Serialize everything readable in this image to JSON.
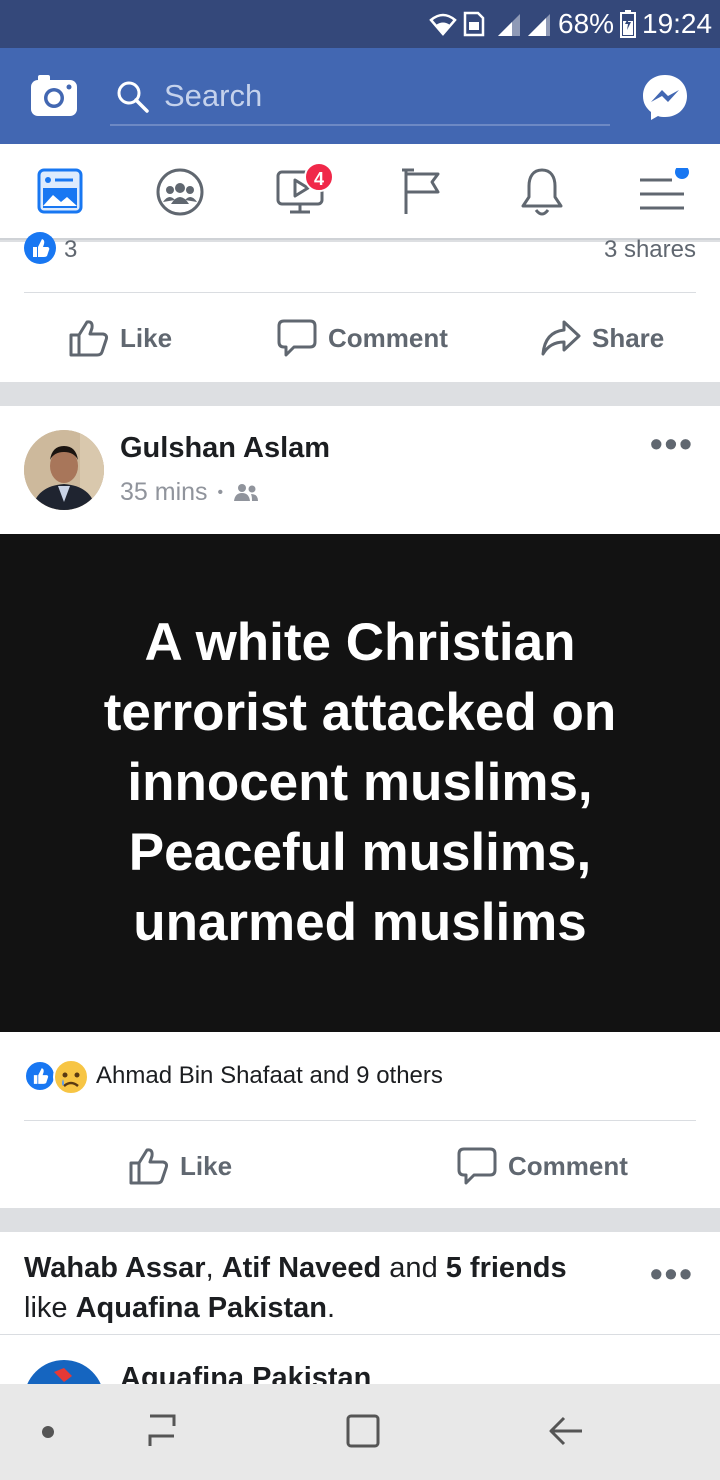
{
  "status_bar": {
    "battery": "68%",
    "time": "19:24"
  },
  "top_bar": {
    "search_placeholder": "Search"
  },
  "nav_tabs": [
    {
      "icon": "news-feed-icon"
    },
    {
      "icon": "groups-icon"
    },
    {
      "icon": "watch-icon",
      "badge": "4"
    },
    {
      "icon": "pages-flag-icon"
    },
    {
      "icon": "notifications-bell-icon"
    },
    {
      "icon": "menu-icon"
    }
  ],
  "prev_post": {
    "reaction_count": "3",
    "shares": "3 shares",
    "like_label": "Like",
    "comment_label": "Comment",
    "share_label": "Share"
  },
  "post": {
    "author": "Gulshan Aslam",
    "time": "35 mins",
    "separator": "•",
    "text_lines": [
      "A white Christian",
      "terrorist attacked on",
      "innocent muslims,",
      "Peaceful muslims,",
      "unarmed muslims"
    ],
    "reactions_text": "Ahmad Bin Shafaat and 9 others",
    "like_label": "Like",
    "comment_label": "Comment",
    "bg_color": "#121212"
  },
  "suggested": {
    "name1": "Wahab Assar",
    "comma": ",",
    "name2": "Atif Naveed",
    "and": " and ",
    "friends": "5 friends",
    "like_word": "like",
    "page": "Aquafina Pakistan",
    "period": ".",
    "page_preview_name": "Aquafina Pakistan"
  },
  "colors": {
    "brand": "#4267b2",
    "status_bar": "#34487a",
    "badge": "#f02849",
    "like_blue": "#1877f2"
  }
}
